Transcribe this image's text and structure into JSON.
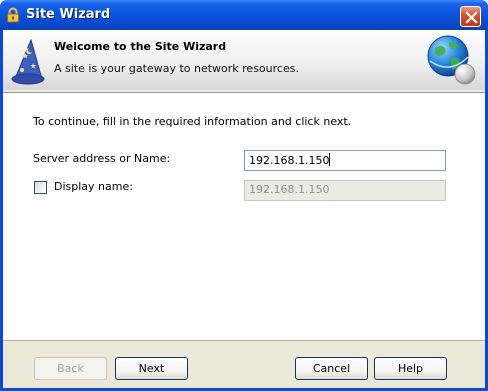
{
  "window": {
    "title": "Site Wizard",
    "title_icon": "lock-icon",
    "close_icon": "close-icon"
  },
  "header": {
    "title": "Welcome to the Site Wizard",
    "subtitle": "A site is your gateway to network resources.",
    "left_icon": "wizard-hat-icon",
    "right_icon": "globe-icon"
  },
  "form": {
    "instructions": "To continue, fill in the required information and click next.",
    "server_label": "Server address or Name:",
    "server_value": "192.168.1.150",
    "display_label": "Display name:",
    "display_value": "192.168.1.150",
    "display_checked": false
  },
  "buttons": {
    "back": "Back",
    "next": "Next",
    "cancel": "Cancel",
    "help": "Help"
  }
}
